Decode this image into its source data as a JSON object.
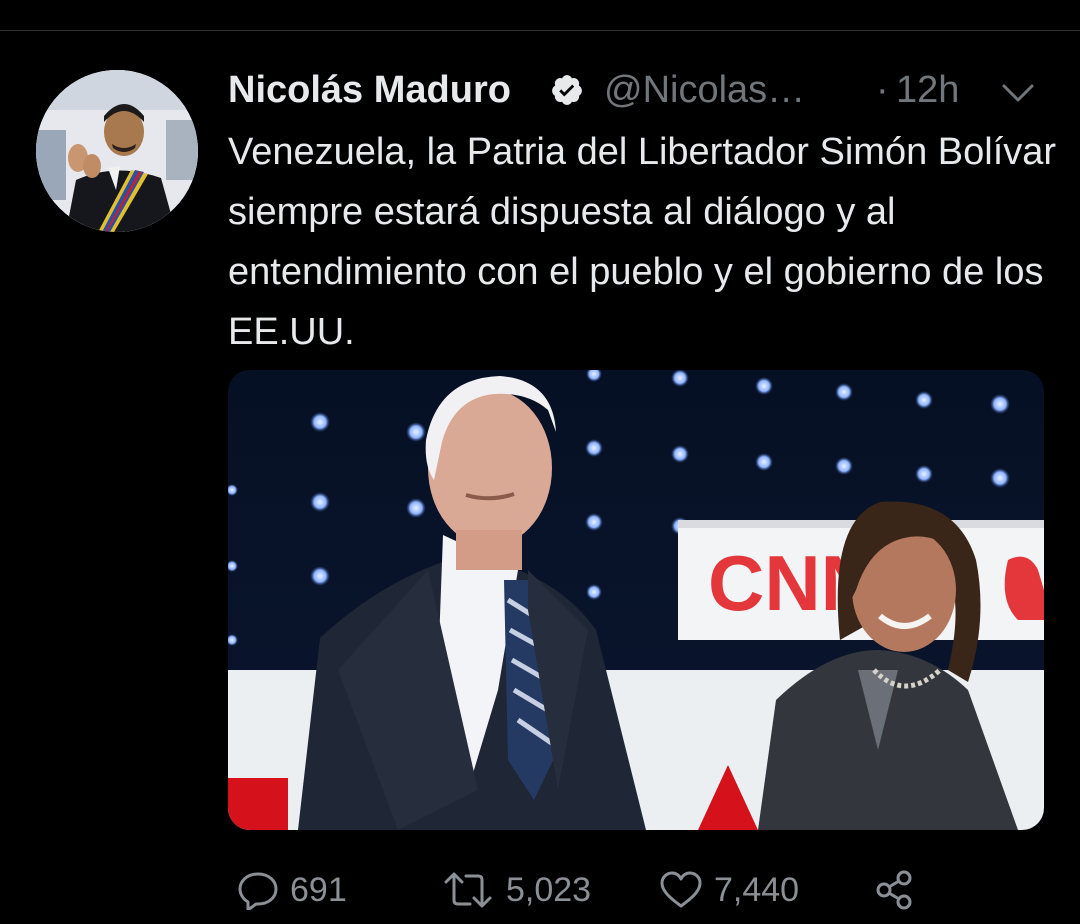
{
  "tweet": {
    "author_name": "Nicolás Maduro",
    "handle": "@Nicolas…",
    "separator": "·",
    "time": "12h",
    "text": "Venezuela, la Patria del Libertador Simón Bolívar siempre estará dispuesta al diálogo y al entendimiento con el pueblo y el gobierno de los EE.UU.",
    "verified": true
  },
  "media": {
    "backdrop_logo": "CNN"
  },
  "actions": {
    "replies": "691",
    "retweets": "5,023",
    "likes": "7,440"
  },
  "icons": {
    "verified": "verified-badge-icon",
    "caret": "chevron-down-icon",
    "reply": "reply-icon",
    "retweet": "retweet-icon",
    "like": "heart-icon",
    "share": "share-icon"
  },
  "colors": {
    "background": "#000000",
    "text_primary": "#e7e9ea",
    "text_secondary": "#71767b"
  }
}
